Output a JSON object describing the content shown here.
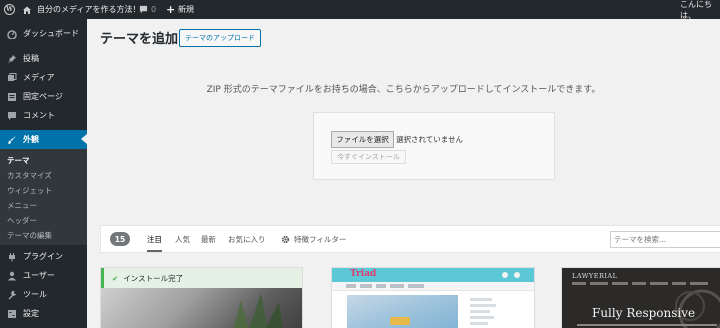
{
  "admin_bar": {
    "site_name": "自分のメディアを作る方法！",
    "comment_count": "0",
    "new_label": "新規",
    "greeting": "こんにちは、"
  },
  "sidebar": {
    "items": [
      {
        "label": "ダッシュボード",
        "icon": "dashboard-icon"
      },
      {
        "label": "投稿",
        "icon": "pin-icon"
      },
      {
        "label": "メディア",
        "icon": "media-icon"
      },
      {
        "label": "固定ページ",
        "icon": "page-icon"
      },
      {
        "label": "コメント",
        "icon": "comment-icon"
      },
      {
        "label": "外観",
        "icon": "brush-icon"
      },
      {
        "label": "プラグイン",
        "icon": "plugin-icon"
      },
      {
        "label": "ユーザー",
        "icon": "user-icon"
      },
      {
        "label": "ツール",
        "icon": "wrench-icon"
      },
      {
        "label": "設定",
        "icon": "settings-icon"
      }
    ],
    "submenu": [
      "テーマ",
      "カスタマイズ",
      "ウィジェット",
      "メニュー",
      "ヘッダー",
      "テーマの編集"
    ]
  },
  "main": {
    "title": "テーマを追加",
    "upload_button": "テーマのアップロード",
    "upload_message": "ZIP 形式のテーマファイルをお持ちの場合、こちらからアップロードしてインストールできます。",
    "choose_file": "ファイルを選択",
    "no_file_selected": "選択されていません",
    "install_now": "今すぐインストール"
  },
  "filter_bar": {
    "count": "15",
    "tabs": [
      "注目",
      "人気",
      "最新",
      "お気に入り"
    ],
    "feature_filter": "特徴フィルター",
    "search_placeholder": "テーマを検索..."
  },
  "themes": [
    {
      "banner": "インストール完了"
    },
    {
      "name": "Triad"
    },
    {
      "logo": "LAWYERIAL",
      "headline": "Fully Responsive"
    }
  ]
}
